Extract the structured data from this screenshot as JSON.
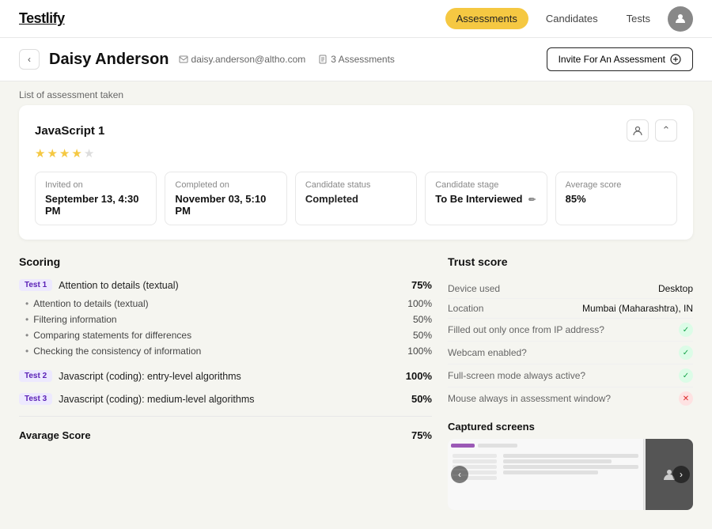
{
  "app": {
    "logo": "Testlify"
  },
  "nav": {
    "items": [
      {
        "label": "Assessments",
        "active": true
      },
      {
        "label": "Candidates",
        "active": false
      },
      {
        "label": "Tests",
        "active": false
      }
    ]
  },
  "candidate": {
    "name": "Daisy Anderson",
    "email": "daisy.anderson@altho.com",
    "assessments_count": "3 Assessments",
    "invite_btn": "Invite For An Assessment"
  },
  "breadcrumb": "List of assessment taken",
  "assessment": {
    "title": "JavaScript 1",
    "stars": [
      1,
      1,
      1,
      1,
      0
    ],
    "stats": [
      {
        "label": "Invited on",
        "value": "September 13, 4:30 PM"
      },
      {
        "label": "Completed on",
        "value": "November 03, 5:10 PM"
      },
      {
        "label": "Candidate status",
        "value": "Completed"
      },
      {
        "label": "Candidate stage",
        "value": "To Be Interviewed",
        "editable": true
      },
      {
        "label": "Average score",
        "value": "85%"
      }
    ]
  },
  "scoring": {
    "title": "Scoring",
    "tests": [
      {
        "badge": "Test 1",
        "name": "Attention to details (textual)",
        "score": "75%",
        "sub_items": [
          {
            "name": "Attention to details (textual)",
            "score": "100%"
          },
          {
            "name": "Filtering information",
            "score": "50%"
          },
          {
            "name": "Comparing statements for differences",
            "score": "50%"
          },
          {
            "name": "Checking the consistency of information",
            "score": "100%"
          }
        ]
      },
      {
        "badge": "Test 2",
        "name": "Javascript (coding): entry-level algorithms",
        "score": "100%",
        "sub_items": []
      },
      {
        "badge": "Test 3",
        "name": "Javascript (coding): medium-level algorithms",
        "score": "50%",
        "sub_items": []
      }
    ],
    "average_label": "Avarage Score",
    "average_score": "75%"
  },
  "trust_score": {
    "title": "Trust score",
    "rows": [
      {
        "key": "Device used",
        "value": "Desktop",
        "type": "text"
      },
      {
        "key": "Location",
        "value": "Mumbai (Maharashtra), IN",
        "type": "text"
      },
      {
        "key": "Filled out only once from IP address?",
        "value": "",
        "type": "check"
      },
      {
        "key": "Webcam enabled?",
        "value": "",
        "type": "check"
      },
      {
        "key": "Full-screen mode always active?",
        "value": "",
        "type": "check"
      },
      {
        "key": "Mouse always in assessment window?",
        "value": "",
        "type": "cross"
      }
    ]
  },
  "captured_screens": {
    "title": "Captured screens"
  }
}
